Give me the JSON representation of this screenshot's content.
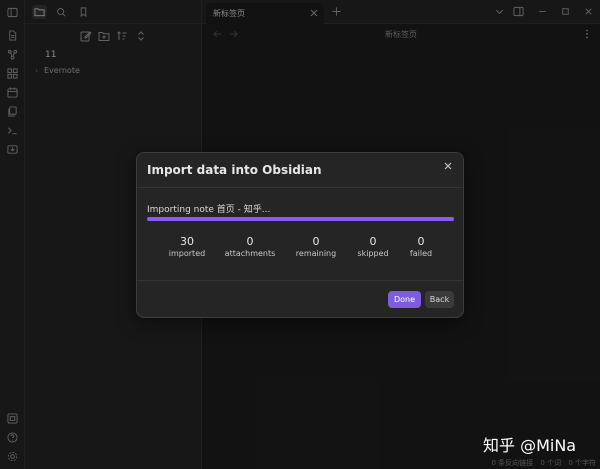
{
  "ribbon": {
    "icons": [
      "files-icon",
      "graph-icon",
      "canvas-icon",
      "calendar-icon",
      "templates-icon",
      "terminal-icon",
      "import-icon"
    ],
    "bottom_icons": [
      "vault-icon",
      "help-icon",
      "settings-icon"
    ]
  },
  "sidebar": {
    "vault_name": "11",
    "tree": [
      {
        "label": "Evernote",
        "collapsed": true
      }
    ]
  },
  "tabs": [
    {
      "title": "新标签页"
    }
  ],
  "view": {
    "title": "新标签页"
  },
  "modal": {
    "title": "Import data into Obsidian",
    "status": "Importing note 首页 - 知乎...",
    "progress": 1.0,
    "stats": [
      {
        "value": "30",
        "label": "imported"
      },
      {
        "value": "0",
        "label": "attachments"
      },
      {
        "value": "0",
        "label": "remaining"
      },
      {
        "value": "0",
        "label": "skipped"
      },
      {
        "value": "0",
        "label": "failed"
      }
    ],
    "done_label": "Done",
    "back_label": "Back"
  },
  "statusbar": {
    "backlinks": "0 条反向链接",
    "words": "0 个词",
    "chars": "0 个字符"
  },
  "watermark": "知乎 @MiNa",
  "colors": {
    "accent": "#7c5ce0",
    "background": "#1e1e1e",
    "panel": "#262626"
  }
}
